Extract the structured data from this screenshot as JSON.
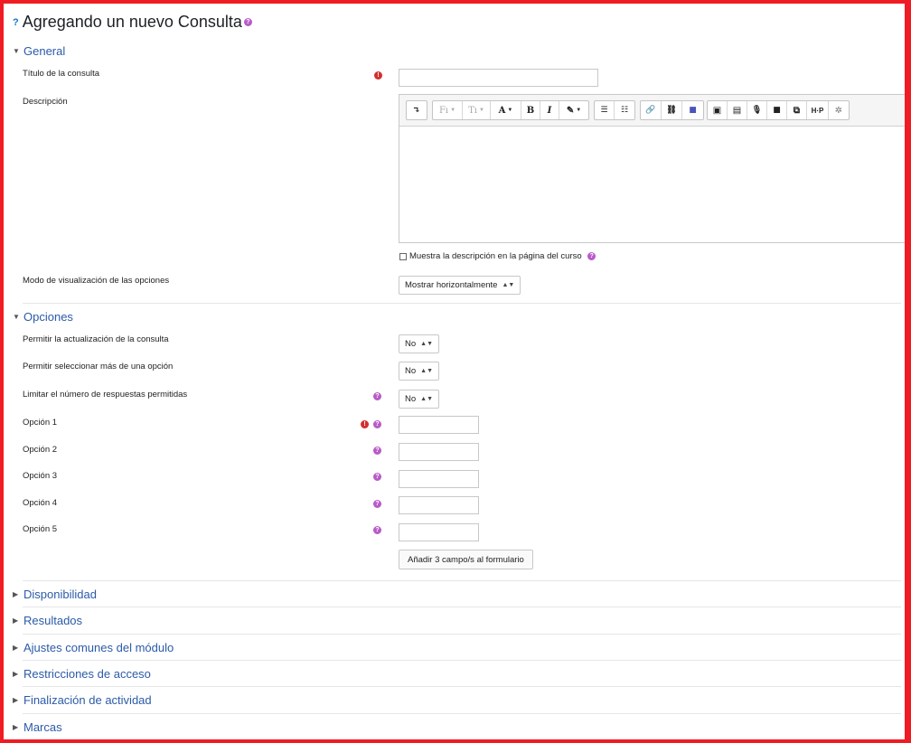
{
  "page": {
    "title": "Agregando un nuevo Consulta",
    "title_help_glyph": "?",
    "help_glyph": "?",
    "required_glyph": "!"
  },
  "general": {
    "heading": "General",
    "titulo_label": "Título de la consulta",
    "titulo_value": "",
    "descripcion_label": "Descripción",
    "show_desc_label": "Muestra la descripción en la página del curso",
    "show_desc_checked": false,
    "modo_label": "Modo de visualización de las opciones",
    "modo_value": "Mostrar horizontalmente"
  },
  "editor": {
    "toolbar": {
      "collapse": "↴",
      "font_family": "Fı",
      "font_size": "Tı",
      "font_color": "A",
      "bold": "B",
      "italic": "I",
      "highlight": "✎",
      "ul": "☰",
      "ol": "☷",
      "link": "🔗",
      "unlink": "⛓",
      "teams": "■",
      "image": "▣",
      "media": "▤",
      "record_audio": "🎙",
      "record_video": "■",
      "manage_files": "⧉",
      "h5p": "H·P",
      "accessibility": "✲"
    },
    "content": ""
  },
  "opciones": {
    "heading": "Opciones",
    "permitir_actualizacion_label": "Permitir la actualización de la consulta",
    "permitir_actualizacion_value": "No",
    "permitir_multiple_label": "Permitir seleccionar más de una opción",
    "permitir_multiple_value": "No",
    "limitar_label": "Limitar el número de respuestas permitidas",
    "limitar_value": "No",
    "options": [
      {
        "label": "Opción 1",
        "value": ""
      },
      {
        "label": "Opción 2",
        "value": ""
      },
      {
        "label": "Opción 3",
        "value": ""
      },
      {
        "label": "Opción 4",
        "value": ""
      },
      {
        "label": "Opción 5",
        "value": ""
      }
    ],
    "add_fields_button": "Añadir 3 campo/s al formulario"
  },
  "collapsed_sections": [
    "Disponibilidad",
    "Resultados",
    "Ajustes comunes del módulo",
    "Restricciones de acceso",
    "Finalización de actividad",
    "Marcas"
  ],
  "colors": {
    "frame": "#ef1c24",
    "section_link": "#2b5aa8",
    "help": "#b85bc7",
    "required": "#d32f2f"
  }
}
